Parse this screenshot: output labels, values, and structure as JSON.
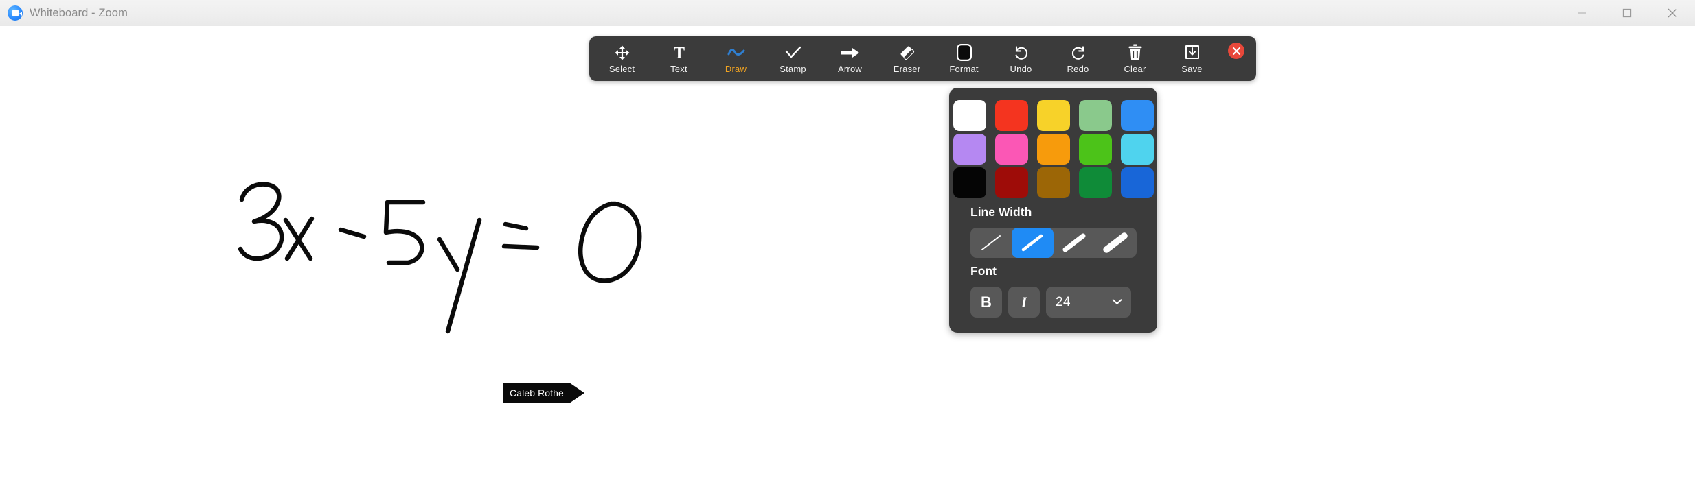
{
  "window": {
    "title": "Whiteboard - Zoom",
    "app_icon": "zoom-video-icon",
    "controls": {
      "minimize": "minimize-icon",
      "maximize": "maximize-icon",
      "close": "close-icon"
    }
  },
  "toolbar": {
    "items": [
      {
        "label": "Select",
        "icon": "move-arrows-icon",
        "active": false
      },
      {
        "label": "Text",
        "icon": "text-t-icon",
        "active": false
      },
      {
        "label": "Draw",
        "icon": "squiggle-icon",
        "active": true
      },
      {
        "label": "Stamp",
        "icon": "checkmark-icon",
        "active": false
      },
      {
        "label": "Arrow",
        "icon": "right-arrow-icon",
        "active": false
      },
      {
        "label": "Eraser",
        "icon": "eraser-icon",
        "active": false
      },
      {
        "label": "Format",
        "icon": "format-square-icon",
        "active": false
      },
      {
        "label": "Undo",
        "icon": "undo-arrow-icon",
        "active": false
      },
      {
        "label": "Redo",
        "icon": "redo-arrow-icon",
        "active": false
      },
      {
        "label": "Clear",
        "icon": "trash-can-icon",
        "active": false
      },
      {
        "label": "Save",
        "icon": "save-download-icon",
        "active": false
      }
    ],
    "close_button": {
      "icon": "close-x-icon",
      "color": "#e8483a"
    }
  },
  "format_panel": {
    "colors": [
      {
        "name": "white",
        "hex": "#ffffff",
        "selected": false
      },
      {
        "name": "red",
        "hex": "#f4341f",
        "selected": false
      },
      {
        "name": "yellow",
        "hex": "#f7d229",
        "selected": false
      },
      {
        "name": "sage-green",
        "hex": "#8ac98c",
        "selected": false
      },
      {
        "name": "blue",
        "hex": "#2f8ef4",
        "selected": false
      },
      {
        "name": "light-purple",
        "hex": "#b588f2",
        "selected": false
      },
      {
        "name": "pink",
        "hex": "#fb57b5",
        "selected": false
      },
      {
        "name": "orange",
        "hex": "#f79b0c",
        "selected": false
      },
      {
        "name": "green",
        "hex": "#4cc319",
        "selected": false
      },
      {
        "name": "cyan",
        "hex": "#4fd3ee",
        "selected": false
      },
      {
        "name": "black",
        "hex": "#050505",
        "selected": true
      },
      {
        "name": "dark-red",
        "hex": "#9e0c08",
        "selected": false
      },
      {
        "name": "brown",
        "hex": "#9c6606",
        "selected": false
      },
      {
        "name": "dark-green",
        "hex": "#0f8b38",
        "selected": false
      },
      {
        "name": "dark-blue",
        "hex": "#1866d8",
        "selected": false
      }
    ],
    "line_width": {
      "title": "Line Width",
      "options": [
        {
          "name": "thin",
          "stroke": 2.0,
          "selected": false
        },
        {
          "name": "medium",
          "stroke": 4.5,
          "selected": true
        },
        {
          "name": "thick",
          "stroke": 7.0,
          "selected": false
        },
        {
          "name": "extra-thick",
          "stroke": 9.5,
          "selected": false
        }
      ],
      "selected_color": "#1f8bf5"
    },
    "font": {
      "title": "Font",
      "bold_label": "B",
      "italic_label": "I",
      "size_value": "24",
      "dropdown_icon": "chevron-down-icon"
    }
  },
  "canvas": {
    "drawing_text": "3x - 5y = 0",
    "stroke_color": "#000000"
  },
  "cursor": {
    "label": "Caleb Rothe",
    "shape": "arrow-pointer"
  }
}
